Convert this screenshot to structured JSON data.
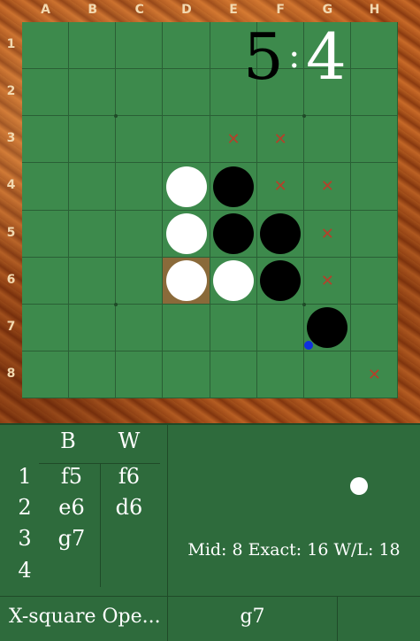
{
  "board": {
    "columns": [
      "A",
      "B",
      "C",
      "D",
      "E",
      "F",
      "G",
      "H"
    ],
    "rows": [
      "1",
      "2",
      "3",
      "4",
      "5",
      "6",
      "7",
      "8"
    ],
    "discs": [
      {
        "sq": "D4",
        "color": "white"
      },
      {
        "sq": "E4",
        "color": "black"
      },
      {
        "sq": "D5",
        "color": "white"
      },
      {
        "sq": "E5",
        "color": "black"
      },
      {
        "sq": "F5",
        "color": "black"
      },
      {
        "sq": "D6",
        "color": "white"
      },
      {
        "sq": "E6",
        "color": "white"
      },
      {
        "sq": "F6",
        "color": "black"
      },
      {
        "sq": "G7",
        "color": "black"
      }
    ],
    "highlight_square": "D6",
    "legal_move_marks": [
      "E3",
      "F3",
      "F4",
      "G4",
      "G5",
      "G6",
      "H8"
    ],
    "last_move_marker": "G7",
    "colors": {
      "board": "#3d8a4c",
      "grid": "#2a5f35",
      "mark": "#b5402a",
      "marker": "#1030e0",
      "highlight": "#8a6a3a"
    }
  },
  "moves": {
    "header_black": "B",
    "header_white": "W",
    "rows": [
      {
        "n": "1",
        "b": "f5",
        "w": "f6"
      },
      {
        "n": "2",
        "b": "e6",
        "w": "d6"
      },
      {
        "n": "3",
        "b": "g7",
        "w": ""
      },
      {
        "n": "4",
        "b": "",
        "w": ""
      }
    ]
  },
  "score": {
    "black": "5",
    "separator": ":",
    "white": "4",
    "turn": "white"
  },
  "engine": {
    "info": "Mid: 8 Exact: 16 W/L: 18"
  },
  "status": {
    "opening": "X-square Ope...",
    "last_move": "g7"
  }
}
